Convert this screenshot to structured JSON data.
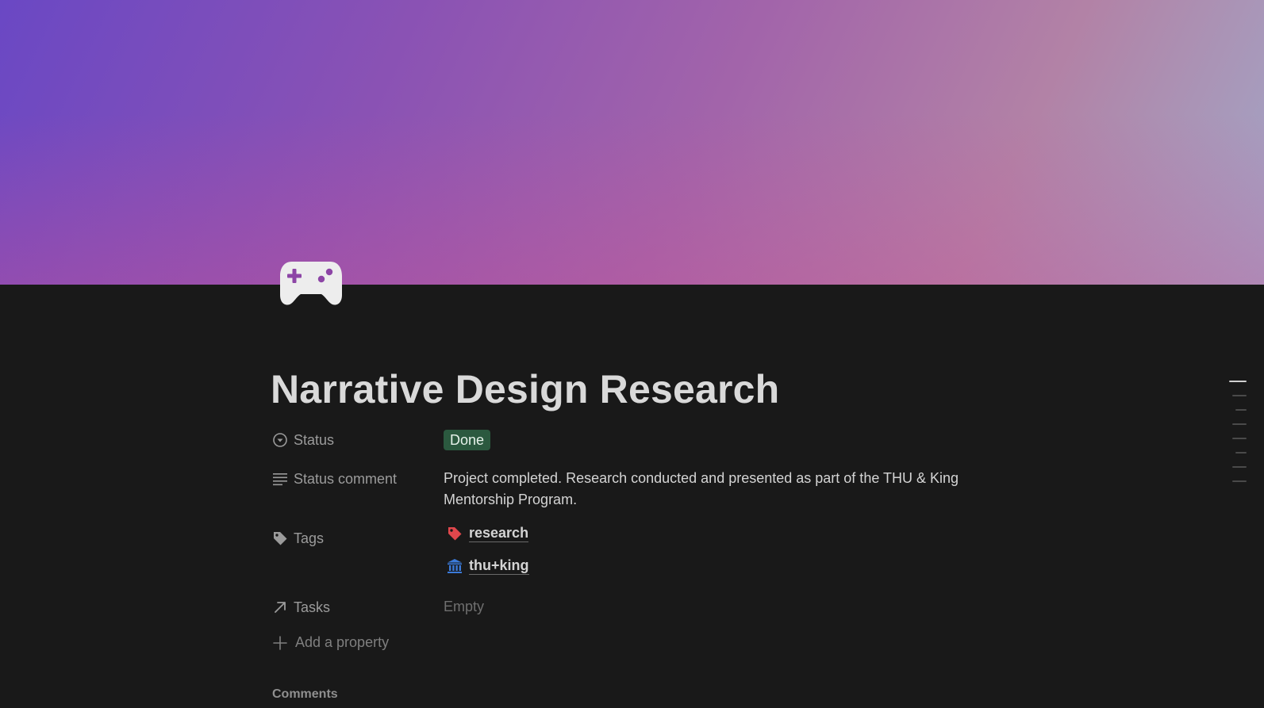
{
  "page": {
    "title": "Narrative Design Research",
    "icon": "game-controller-icon"
  },
  "properties": {
    "status": {
      "label": "Status",
      "value": "Done",
      "color": "#2b593f"
    },
    "status_comment": {
      "label": "Status comment",
      "value": "Project completed. Research conducted and presented as part of the THU & King Mentorship Program."
    },
    "tags": {
      "label": "Tags",
      "items": [
        {
          "label": "research",
          "icon": "red-tag-icon"
        },
        {
          "label": "thu+king",
          "icon": "classical-building-icon"
        }
      ]
    },
    "tasks": {
      "label": "Tasks",
      "value": "Empty"
    },
    "add_property": "Add a property"
  },
  "comments": {
    "heading": "Comments"
  },
  "colors": {
    "background": "#191919",
    "status_done": "#2b593f",
    "tag_red": "#e0474c",
    "building_blue": "#3b7ad9"
  }
}
